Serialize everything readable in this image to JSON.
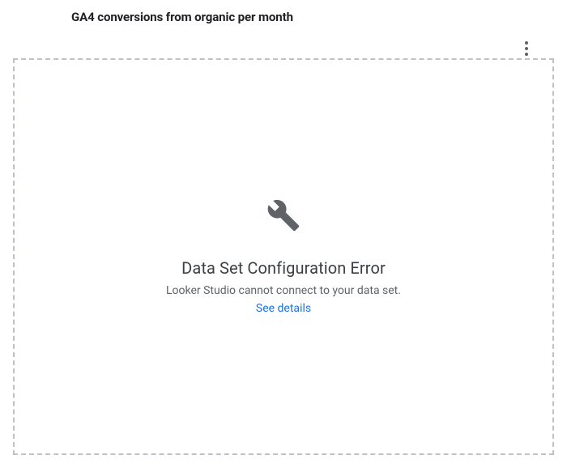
{
  "header": {
    "title": "GA4 conversions from organic per month"
  },
  "error": {
    "title": "Data Set Configuration Error",
    "subtitle": "Looker Studio cannot connect to your data set.",
    "link_label": "See details"
  },
  "icons": {
    "kebab": "more-vert-icon",
    "wrench": "wrench-icon"
  },
  "colors": {
    "text_primary": "#202124",
    "text_secondary": "#5f6368",
    "link": "#1a73e8",
    "border_dashed": "#bdc1c6"
  }
}
